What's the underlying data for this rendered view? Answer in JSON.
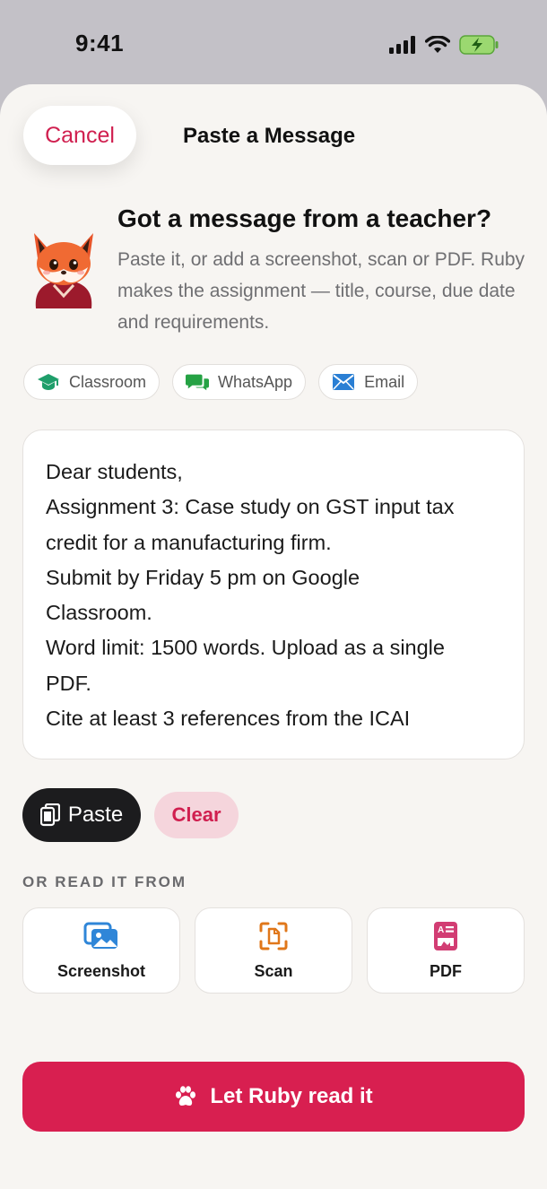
{
  "status_bar": {
    "time": "9:41"
  },
  "header": {
    "cancel_label": "Cancel",
    "title": "Paste a Message"
  },
  "intro": {
    "title": "Got a message from a teacher?",
    "text": "Paste it, or add a screenshot, scan or PDF. Ruby makes the assignment — title, course, due date and requirements."
  },
  "chips": [
    {
      "label": "Classroom",
      "icon": "graduation-cap-icon",
      "color": "#1e9e6a"
    },
    {
      "label": "WhatsApp",
      "icon": "chat-bubbles-icon",
      "color": "#25a244"
    },
    {
      "label": "Email",
      "icon": "envelope-icon",
      "color": "#2a7fd4"
    }
  ],
  "message": {
    "lines": [
      "Dear students,",
      "Assignment 3: Case study on GST input tax",
      "credit for a manufacturing firm.",
      "Submit by Friday 5 pm on Google",
      "Classroom.",
      "Word limit: 1500 words. Upload as a single",
      "PDF.",
      "Cite at least 3 references from the ICAI"
    ]
  },
  "actions": {
    "paste_label": "Paste",
    "clear_label": "Clear"
  },
  "sources": {
    "heading": "OR READ IT FROM",
    "items": [
      {
        "label": "Screenshot",
        "icon": "images-icon",
        "color": "#2f86d8"
      },
      {
        "label": "Scan",
        "icon": "document-scan-icon",
        "color": "#e0771a"
      },
      {
        "label": "PDF",
        "icon": "pdf-document-icon",
        "color": "#d23d73"
      }
    ]
  },
  "cta": {
    "label": "Let Ruby read it",
    "icon": "paw-icon"
  },
  "colors": {
    "accent": "#d81f50",
    "background": "#f7f5f2",
    "dark_button": "#1c1c1e"
  }
}
